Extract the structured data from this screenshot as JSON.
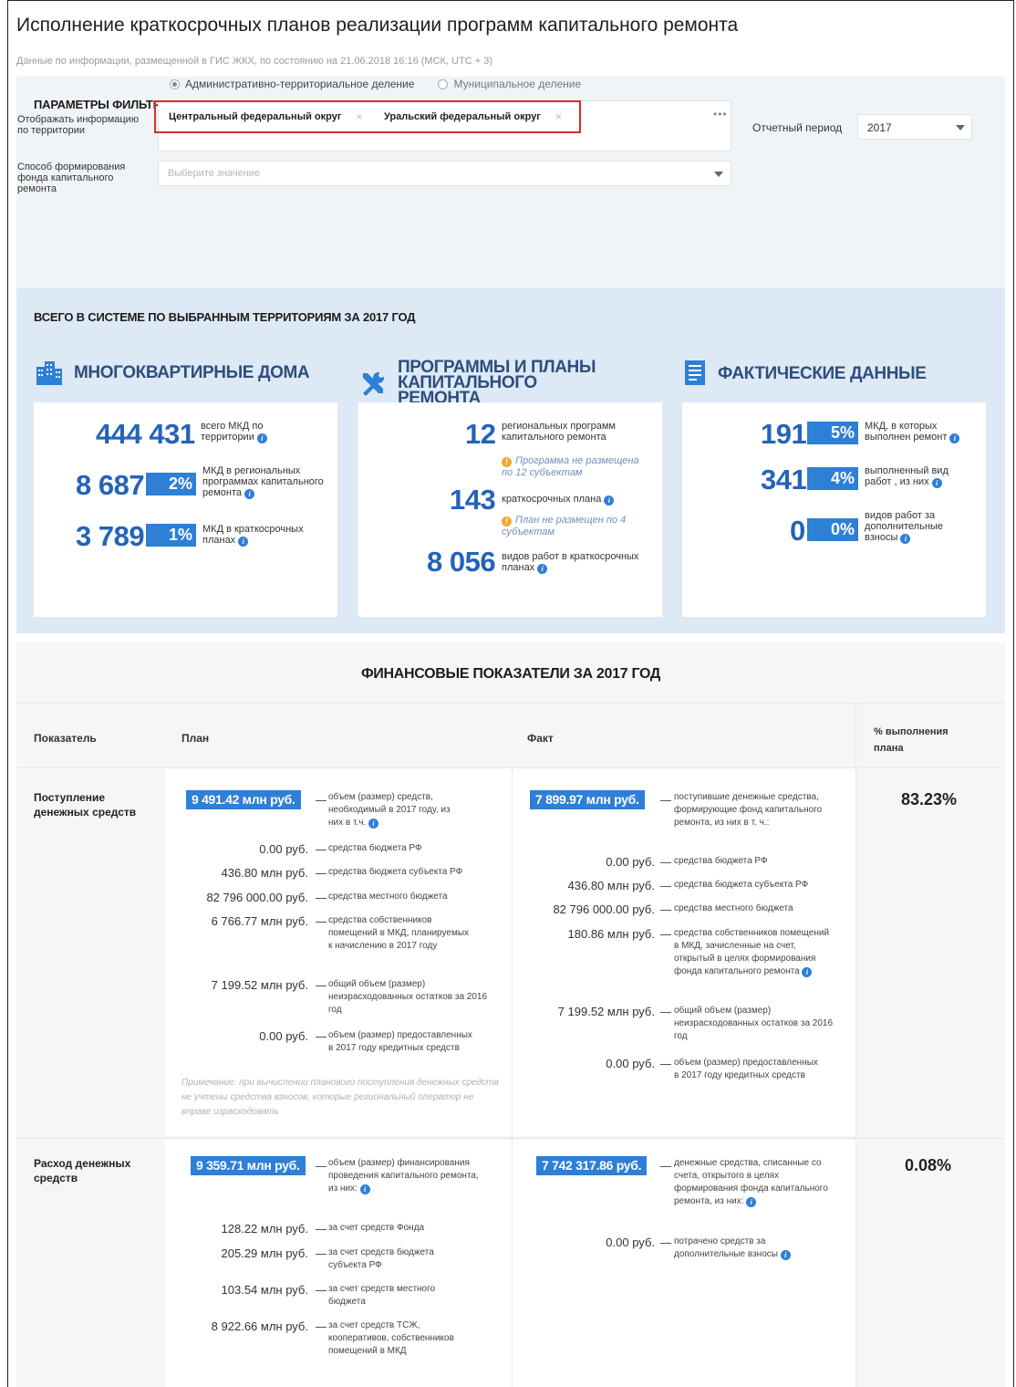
{
  "page": {
    "title": "Исполнение краткосрочных планов реализации программ капитального ремонта",
    "subtitle": "Данные по информации, размещенной в ГИС ЖКХ, по состоянию на 21.06.2018 16:16 (МСК, UTC + 3)"
  },
  "filters": {
    "title": "ПАРАМЕТРЫ ФИЛЬТРАЦИИ",
    "radio_admin": "Административно-территориальное деление",
    "radio_municipal": "Муниципальное деление",
    "territory_label": "Отображать информацию по территории",
    "territory_tags": [
      "Центральный федеральный округ",
      "Уральский федеральный округ"
    ],
    "tag_remove": "×",
    "more": "•••",
    "period_label": "Отчетный период",
    "period_value": "2017",
    "method_label": "Способ формирования фонда капитального ремонта",
    "method_placeholder": "Выберите значение"
  },
  "totals": {
    "title": "ВСЕГО В СИСТЕМЕ ПО ВЫБРАННЫМ ТЕРРИТОРИЯМ ЗА 2017 ГОД",
    "col1": {
      "head": "МНОГОКВАРТИРНЫЕ ДОМА",
      "total_value": "444 431",
      "total_label": "всего МКД по территории",
      "reg_value": "8 687",
      "reg_pct": "2%",
      "reg_label": "МКД в региональных программах капитального ремонта",
      "short_value": "3 789",
      "short_pct": "1%",
      "short_label": "МКД в краткосрочных планах"
    },
    "col2": {
      "head": "ПРОГРАММЫ И ПЛАНЫ КАПИТАЛЬНОГО РЕМОНТА",
      "programs_value": "12",
      "programs_label": "региональных программ капитального ремонта",
      "programs_warn": "Программа не размещена по 12 субъектам",
      "plans_value": "143",
      "plans_label": "краткосрочных плана",
      "plans_warn": "План не размещен по 4 субъектам",
      "works_value": "8 056",
      "works_label": "видов работ в краткосрочных планах"
    },
    "col3": {
      "head": "ФАКТИЧЕСКИЕ ДАННЫЕ",
      "done_value": "191",
      "done_pct": "5%",
      "done_label": "МКД, в которых выполнен ремонт",
      "works_value": "341",
      "works_pct": "4%",
      "works_label": "выполненный вид работ , из них",
      "extra_value": "0",
      "extra_pct": "0%",
      "extra_label": "видов работ за дополнительные взносы"
    }
  },
  "finance": {
    "title": "ФИНАНСОВЫЕ ПОКАЗАТЕЛИ ЗА 2017 ГОД",
    "headers": {
      "indicator": "Показатель",
      "plan": "План",
      "fact": "Факт",
      "pct": "% выполнения плана"
    },
    "income": {
      "label": "Поступление денежных средств",
      "plan_total": "9 491.42 млн руб.",
      "plan_total_desc": "объем (размер) средств, необходимый в 2017 году, из них в т.ч.",
      "plan_items": [
        {
          "amount": "0.00 руб.",
          "desc": "средства бюджета РФ"
        },
        {
          "amount": "436.80 млн руб.",
          "desc": "средства бюджета субъекта РФ"
        },
        {
          "amount": "82 796 000.00 руб.",
          "desc": "средства местного бюджета"
        },
        {
          "amount": "6 766.77 млн руб.",
          "desc": "средства собственников помещений в МКД, планируемых к начислению в 2017 году"
        },
        {
          "amount": "7 199.52 млн руб.",
          "desc": "общий объем (размер) неизрасходованных остатков за 2016 год"
        },
        {
          "amount": "0.00 руб.",
          "desc": "объем (размер) предоставленных в 2017 году кредитных средств"
        }
      ],
      "plan_note": "Примечание: при вычислении планового поступления денежных средств не учтены средства взносов, которые региональный оператор не вправе израсходовать",
      "fact_total": "7 899.97 млн руб.",
      "fact_total_desc": "поступившие денежные средства, формирующие фонд капитального ремонта, из них в т. ч.:",
      "fact_items": [
        {
          "amount": "0.00 руб.",
          "desc": "средства бюджета РФ"
        },
        {
          "amount": "436.80 млн руб.",
          "desc": "средства бюджета субъекта РФ"
        },
        {
          "amount": "82 796 000.00 руб.",
          "desc": "средства местного бюджета"
        },
        {
          "amount": "180.86 млн руб.",
          "desc": "средства собственников помещений в МКД, зачисленные на счет, открытый в целях формирования фонда капитального ремонта"
        },
        {
          "amount": "7 199.52 млн руб.",
          "desc": "общий объем (размер) неизрасходованных остатков за 2016 год"
        },
        {
          "amount": "0.00 руб.",
          "desc": "объем (размер) предоставленных в 2017 году кредитных средств"
        }
      ],
      "pct": "83.23%"
    },
    "expense": {
      "label": "Расход денежных средств",
      "plan_total": "9 359.71 млн руб.",
      "plan_total_desc": "объем (размер) финансирования проведения капитального ремонта, из них:",
      "plan_items": [
        {
          "amount": "128.22 млн руб.",
          "desc": "за счет средств Фонда"
        },
        {
          "amount": "205.29 млн руб.",
          "desc": "за счет средств бюджета субъекта РФ"
        },
        {
          "amount": "103.54 млн руб.",
          "desc": "за счет средств местного бюджета"
        },
        {
          "amount": "8 922.66 млн руб.",
          "desc": "за счет средств ТСЖ, кооперативов, собственников помещений в МКД"
        }
      ],
      "fact_total": "7 742 317.86 руб.",
      "fact_total_desc": "денежные средства, списанные со счета, открытого в целях формирования фонда капитального ремонта, из них:",
      "fact_items": [
        {
          "amount": "0.00 руб.",
          "desc": "потрачено средств за дополнительные взносы"
        }
      ],
      "pct": "0.08%"
    }
  }
}
